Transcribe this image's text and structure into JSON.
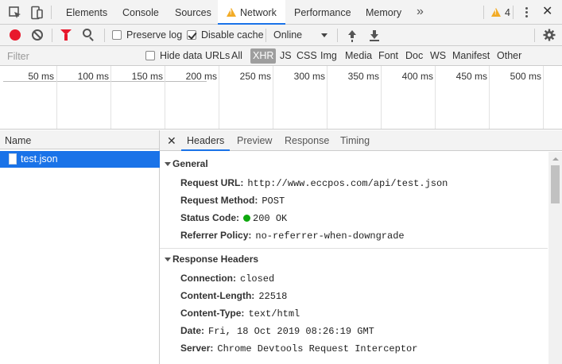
{
  "tabbar": {
    "tabs": [
      {
        "label": "Elements"
      },
      {
        "label": "Console"
      },
      {
        "label": "Sources"
      },
      {
        "label": "Network"
      },
      {
        "label": "Performance"
      },
      {
        "label": "Memory"
      }
    ],
    "more": "»",
    "warning_count": "4",
    "close": "✕"
  },
  "toolbar": {
    "preserve_log": "Preserve log",
    "disable_cache": "Disable cache",
    "throttling": "Online"
  },
  "filterbar": {
    "placeholder": "Filter",
    "hide_data_urls": "Hide data URLs",
    "types": [
      "All",
      "XHR",
      "JS",
      "CSS",
      "Img",
      "Media",
      "Font",
      "Doc",
      "WS",
      "Manifest",
      "Other"
    ]
  },
  "timeline": {
    "ticks": [
      "50 ms",
      "100 ms",
      "150 ms",
      "200 ms",
      "250 ms",
      "300 ms",
      "350 ms",
      "400 ms",
      "450 ms",
      "500 ms"
    ]
  },
  "requests": {
    "column_header": "Name",
    "rows": [
      {
        "name": "test.json"
      }
    ]
  },
  "details": {
    "close": "✕",
    "tabs": [
      "Headers",
      "Preview",
      "Response",
      "Timing"
    ],
    "general": {
      "title": "General",
      "rows": [
        {
          "key": "Request URL:",
          "value": "http://www.eccpos.com/api/test.json"
        },
        {
          "key": "Request Method:",
          "value": "POST"
        },
        {
          "key": "Status Code:",
          "value": "200 OK"
        },
        {
          "key": "Referrer Policy:",
          "value": "no-referrer-when-downgrade"
        }
      ]
    },
    "response_headers": {
      "title": "Response Headers",
      "rows": [
        {
          "key": "Connection:",
          "value": "closed"
        },
        {
          "key": "Content-Length:",
          "value": "22518"
        },
        {
          "key": "Content-Type:",
          "value": "text/html"
        },
        {
          "key": "Date:",
          "value": "Fri, 18 Oct 2019 08:26:19 GMT"
        },
        {
          "key": "Server:",
          "value": "Chrome Devtools Request Interceptor"
        }
      ]
    }
  },
  "colors": {
    "accent": "#1a73e8",
    "record": "#e8182c",
    "warning": "#f2ab26",
    "status_ok": "#0ea80e"
  }
}
